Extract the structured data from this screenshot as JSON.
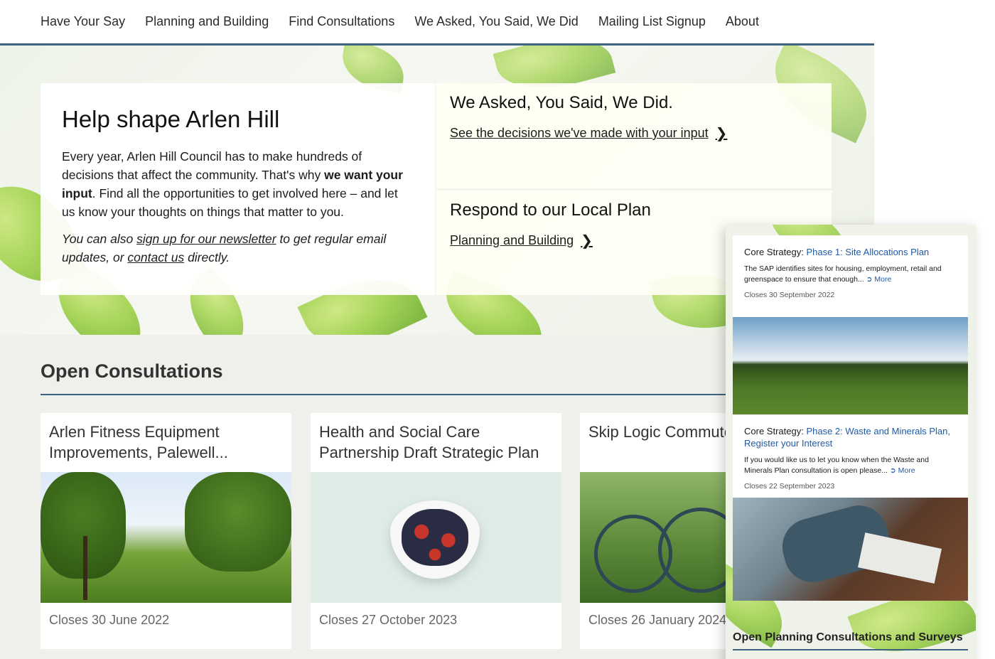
{
  "nav": {
    "items": [
      "Have Your Say",
      "Planning and Building",
      "Find Consultations",
      "We Asked, You Said, We Did",
      "Mailing List Signup",
      "About"
    ]
  },
  "intro": {
    "title": "Help shape Arlen Hill",
    "p1_part1": "Every year, Arlen Hill Council has to make hundreds of decisions that affect the community. That's why ",
    "p1_bold": "we want your input",
    "p1_part2": ". Find all the opportunities to get involved here – and let us know your thoughts on things that matter to you.",
    "p2_part1": "You can also ",
    "p2_link1": "sign up for our newsletter",
    "p2_part2": " to get regular email updates, or ",
    "p2_link2": "contact us",
    "p2_part3": " directly."
  },
  "panels": [
    {
      "title": "We Asked, You Said, We Did.",
      "link": "See the decisions we've made with your input"
    },
    {
      "title": "Respond to our Local Plan",
      "link": "Planning and Building"
    }
  ],
  "open_consultations": {
    "title": "Open Consultations",
    "cards": [
      {
        "title": "Arlen Fitness Equipment Improvements, Palewell...",
        "closes": "Closes 30 June 2022"
      },
      {
        "title": "Health and Social Care Partnership Draft Strategic Plan",
        "closes": "Closes 27 October 2023"
      },
      {
        "title": "Skip Logic Commute Consultation",
        "closes": "Closes 26 January 2024"
      }
    ]
  },
  "mobile": {
    "cards": [
      {
        "prefix": "Core Strategy: ",
        "link": "Phase 1: Site Allocations Plan",
        "desc": "The SAP identifies sites for housing, employment, retail and greenspace to ensure that enough...",
        "more": "More",
        "closes": "Closes 30 September 2022"
      },
      {
        "prefix": "Core Strategy: ",
        "link": "Phase 2: Waste and Minerals Plan, Register your Interest",
        "desc": "If you would like us to let you know when the Waste and Minerals Plan consultation is open please...",
        "more": "More",
        "closes": "Closes 22 September 2023"
      }
    ],
    "footer_title": "Open Planning Consultations and Surveys"
  },
  "icons": {
    "chevron": "chevron-right-icon",
    "more": "circle-arrow-right-icon"
  },
  "colors": {
    "accent": "#3d6382",
    "link": "#1f5aa6",
    "leaf": "#9fd14a"
  }
}
